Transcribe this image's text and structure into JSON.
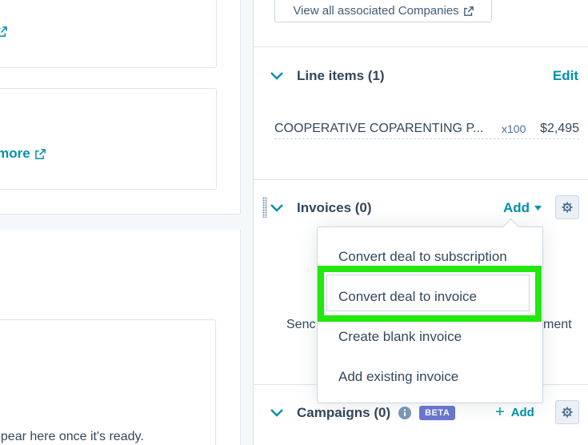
{
  "left": {
    "card1_link": "e",
    "card2_link": "n more",
    "ready_text": "ppear here once it's ready."
  },
  "associations": {
    "view_all_label": "View all associated Companies"
  },
  "line_items": {
    "title": "Line items (1)",
    "edit_label": "Edit",
    "item": {
      "name": "COOPERATIVE COPARENTING P...",
      "qty": "x100",
      "price": "$2,495"
    }
  },
  "invoices": {
    "title": "Invoices (0)",
    "add_label": "Add",
    "body_left": "Senc",
    "body_right": "ment",
    "menu": [
      "Convert deal to subscription",
      "Convert deal to invoice",
      "Create blank invoice",
      "Add existing invoice"
    ]
  },
  "campaigns": {
    "title": "Campaigns (0)",
    "badge": "BETA",
    "add_label": "Add"
  },
  "colors": {
    "link": "#0091ae",
    "text": "#33475b",
    "highlight": "#22e80e",
    "badge": "#6a78d1"
  }
}
